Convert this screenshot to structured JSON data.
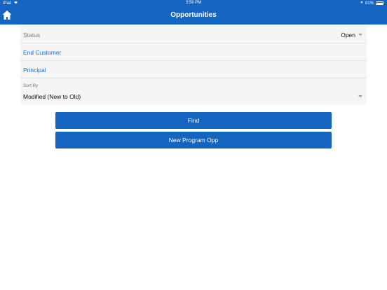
{
  "statusbar": {
    "carrier": "iPad",
    "time": "3:59 PM",
    "battery": "81%"
  },
  "header": {
    "title": "Opportunities",
    "home_icon": "home-icon"
  },
  "form": {
    "status": {
      "label": "Status",
      "value": "Open"
    },
    "end_customer": {
      "label": "End Customer"
    },
    "principal": {
      "label": "Principal"
    },
    "sort": {
      "label": "Sort By",
      "value": "Modified (New to Old)"
    }
  },
  "buttons": {
    "find": "Find",
    "new_program": "New Program Opp"
  },
  "colors": {
    "primary": "#1565c0",
    "link": "#1e6fc9",
    "form_bg": "#f5f5f5"
  }
}
